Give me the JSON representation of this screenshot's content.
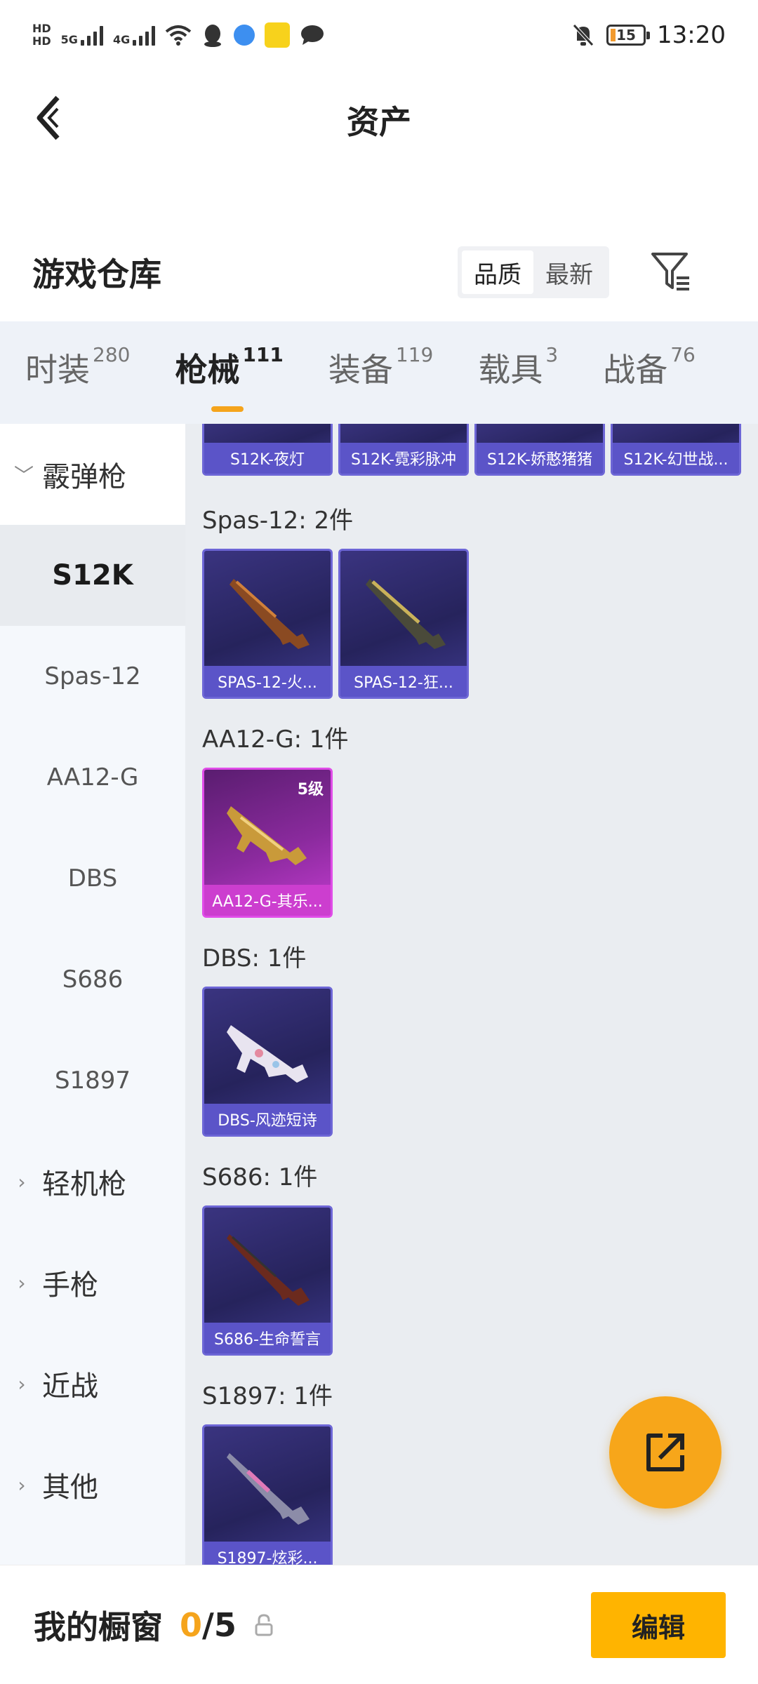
{
  "status_bar": {
    "hd1": "HD",
    "hd2": "HD",
    "net1": "5G",
    "net2": "4G",
    "battery": "15",
    "time": "13:20"
  },
  "header": {
    "title": "资产"
  },
  "warehouse": {
    "title": "游戏仓库",
    "sort_quality": "品质",
    "sort_latest": "最新"
  },
  "tabs": [
    {
      "label": "时装",
      "count": "280"
    },
    {
      "label": "枪械",
      "count": "111"
    },
    {
      "label": "装备",
      "count": "119"
    },
    {
      "label": "载具",
      "count": "3"
    },
    {
      "label": "战备",
      "count": "76"
    }
  ],
  "sidenav": {
    "shotgun_group": "霰弹枪",
    "items": [
      "S12K",
      "Spas-12",
      "AA12-G",
      "DBS",
      "S686",
      "S1897"
    ],
    "groups": [
      "轻机枪",
      "手枪",
      "近战",
      "其他"
    ]
  },
  "content": {
    "top_row": [
      "S12K-夜灯",
      "S12K-霓彩脉冲",
      "S12K-娇憨猪猪",
      "S12K-幻世战..."
    ],
    "sections": [
      {
        "label": "Spas-12: 2件",
        "cards": [
          "SPAS-12-火...",
          "SPAS-12-狂..."
        ]
      },
      {
        "label": "AA12-G: 1件",
        "cards": [
          "AA12-G-其乐..."
        ],
        "level": "5级"
      },
      {
        "label": "DBS: 1件",
        "cards": [
          "DBS-风迹短诗"
        ]
      },
      {
        "label": "S686: 1件",
        "cards": [
          "S686-生命誓言"
        ]
      },
      {
        "label": "S1897: 1件",
        "cards": [
          "S1897-炫彩..."
        ]
      }
    ]
  },
  "bottom": {
    "showcase_label": "我的橱窗",
    "current": "0",
    "total": "/5",
    "edit": "编辑"
  },
  "colors": {
    "accent": "#f5a41c",
    "card_blue": "#5b54c8",
    "card_purple": "#cc3ecf",
    "edit_button": "#ffb400"
  }
}
